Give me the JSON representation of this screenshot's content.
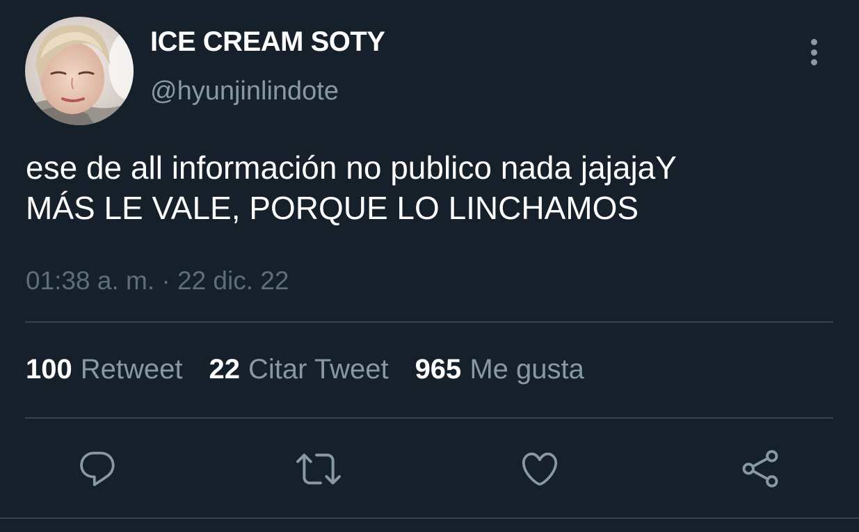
{
  "tweet": {
    "display_name": "ICE CREAM SOTY",
    "handle": "@hyunjinlindote",
    "text_line1": "ese de all información no publico nada jajajaY",
    "text_line2": "MÁS LE VALE, PORQUE LO LINCHAMOS",
    "timestamp": "01:38 a. m. · 22 dic. 22"
  },
  "stats": {
    "retweets_count": "100",
    "retweets_label": "Retweet",
    "quotes_count": "22",
    "quotes_label": "Citar Tweet",
    "likes_count": "965",
    "likes_label": "Me gusta"
  },
  "actions": {
    "reply_icon": "comment-icon",
    "retweet_icon": "retweet-icon",
    "like_icon": "heart-icon",
    "share_icon": "share-icon"
  },
  "colors": {
    "background": "#15202b",
    "primary_text": "#ffffff",
    "secondary_text": "#8899a6",
    "divider": "#38444d"
  }
}
